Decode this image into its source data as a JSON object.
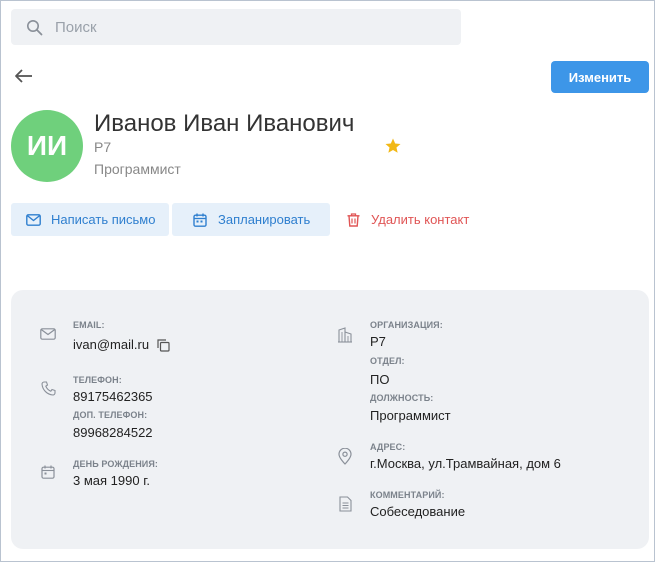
{
  "search": {
    "placeholder": "Поиск"
  },
  "header": {
    "edit_label": "Изменить"
  },
  "contact": {
    "initials": "ИИ",
    "name": "Иванов Иван Иванович",
    "organization": "Р7",
    "position": "Программист",
    "favorite": true
  },
  "actions": {
    "write_label": "Написать письмо",
    "schedule_label": "Запланировать",
    "delete_label": "Удалить контакт"
  },
  "details": {
    "email": {
      "label": "EMAIL:",
      "value": "ivan@mail.ru"
    },
    "phone": {
      "label": "ТЕЛЕФОН:",
      "value": "89175462365"
    },
    "phone2": {
      "label": "ДОП. ТЕЛЕФОН:",
      "value": "89968284522"
    },
    "birthday": {
      "label": "ДЕНЬ РОЖДЕНИЯ:",
      "value": "3 мая 1990 г."
    },
    "organization": {
      "label": "ОРГАНИЗАЦИЯ:",
      "value": "Р7"
    },
    "department": {
      "label": "ОТДЕЛ:",
      "value": "ПО"
    },
    "position": {
      "label": "ДОЛЖНОСТЬ:",
      "value": "Программист"
    },
    "address": {
      "label": "АДРЕС:",
      "value": "г.Москва, ул.Трамвайная, дом 6"
    },
    "comment": {
      "label": "КОММЕНТАРИЙ:",
      "value": "Собеседование"
    }
  },
  "colors": {
    "accent": "#3d96e8",
    "avatar": "#6fd07c",
    "star": "#f2b816",
    "danger": "#e05555"
  }
}
